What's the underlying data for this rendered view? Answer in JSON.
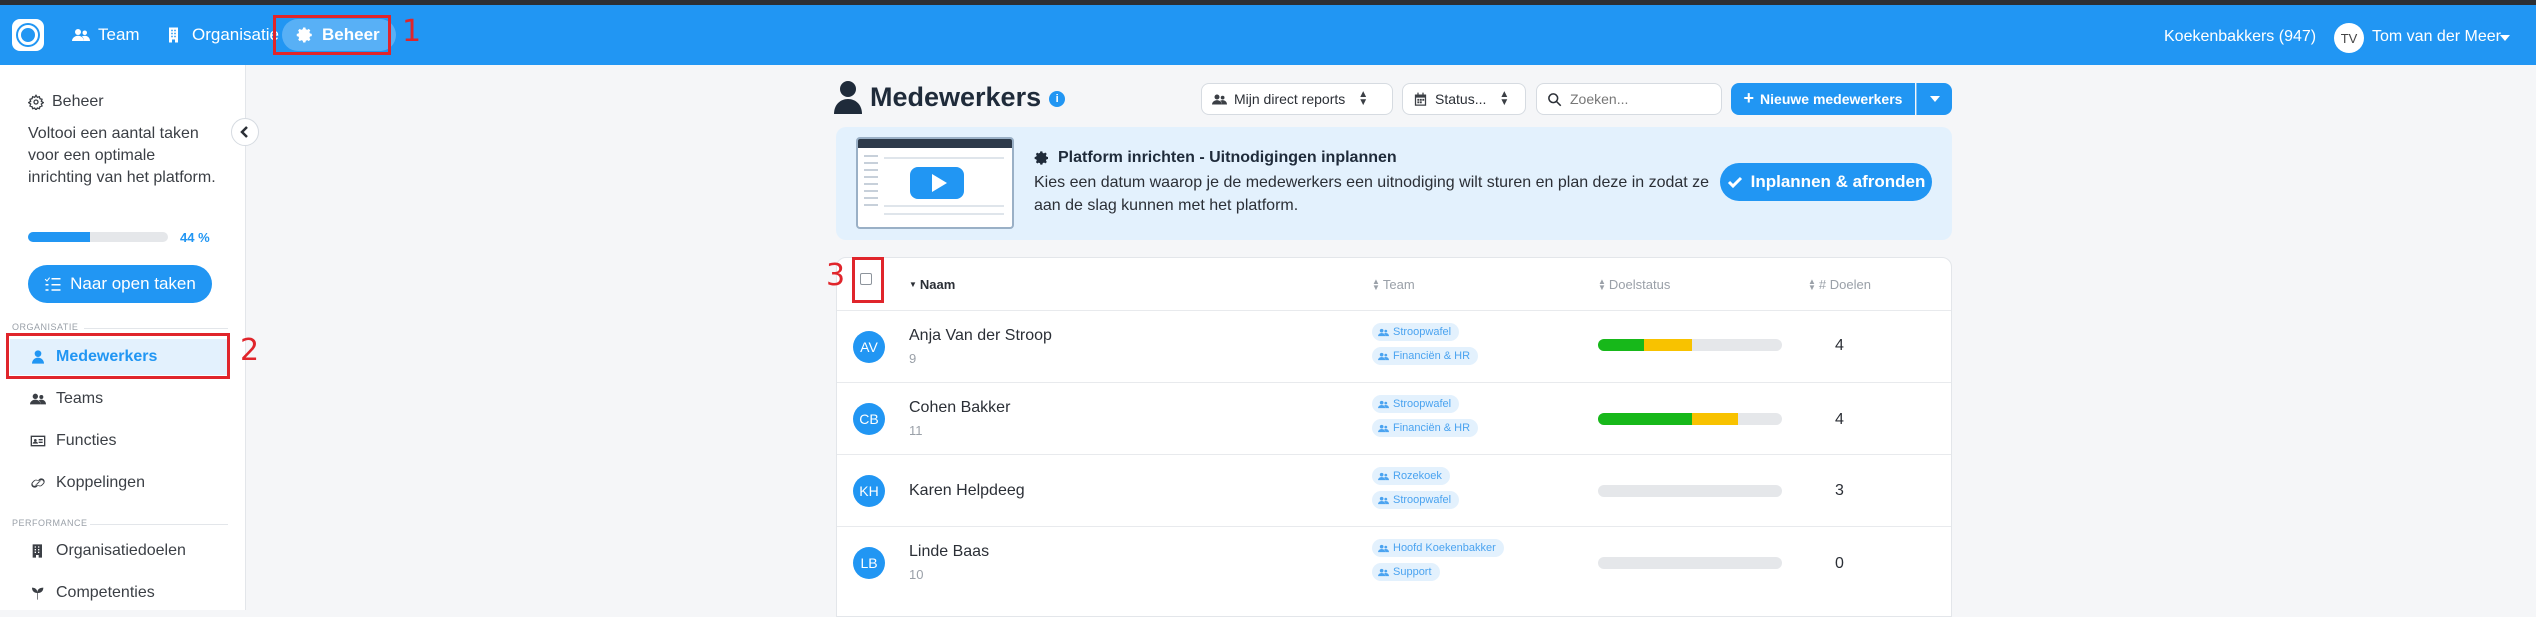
{
  "topbar": {
    "nav": [
      {
        "label": "Team",
        "icon": "users-icon"
      },
      {
        "label": "Organisatie",
        "icon": "building-icon"
      },
      {
        "label": "Beheer",
        "icon": "gear-icon",
        "active": true
      }
    ],
    "org_name": "Koekenbakkers (947)",
    "user_initials": "TV",
    "user_name": "Tom van der Meer"
  },
  "annotations": [
    "1",
    "2",
    "3"
  ],
  "sidebar": {
    "beheer_title": "Beheer",
    "intro_text": "Voltooi een aantal taken voor een optimale inrichting van het platform.",
    "progress_value": 44,
    "progress_label": "44 %",
    "open_tasks_button": "Naar open taken",
    "sections": [
      {
        "label": "ORGANISATIE",
        "items": [
          {
            "label": "Medewerkers",
            "icon": "person-icon",
            "active": true
          },
          {
            "label": "Teams",
            "icon": "users-icon"
          },
          {
            "label": "Functies",
            "icon": "id-card-icon"
          },
          {
            "label": "Koppelingen",
            "icon": "link-icon"
          }
        ]
      },
      {
        "label": "PERFORMANCE",
        "items": [
          {
            "label": "Organisatiedoelen",
            "icon": "building-icon"
          },
          {
            "label": "Competenties",
            "icon": "seedling-icon"
          }
        ]
      }
    ]
  },
  "main": {
    "title": "Medewerkers",
    "filters": {
      "reports": "Mijn direct reports",
      "status": "Status..."
    },
    "search_placeholder": "Zoeken...",
    "new_button": "Nieuwe medewerkers"
  },
  "banner": {
    "title": "Platform inrichten - Uitnodigingen inplannen",
    "text": "Kies een datum waarop je de medewerkers een uitnodiging wilt sturen en plan deze in zodat ze aan de slag kunnen met het platform.",
    "button": "Inplannen & afronden"
  },
  "table": {
    "columns": [
      "Naam",
      "Team",
      "Doelstatus",
      "# Doelen"
    ],
    "rows": [
      {
        "initials": "AV",
        "name": "Anja Van der Stroop",
        "sub": "9",
        "teams": [
          "Stroopwafel",
          "Financiën & HR"
        ],
        "goal_green": 0.25,
        "goal_yellow": 0.26,
        "goals": "4"
      },
      {
        "initials": "CB",
        "name": "Cohen Bakker",
        "sub": "11",
        "teams": [
          "Stroopwafel",
          "Financiën & HR"
        ],
        "goal_green": 0.51,
        "goal_yellow": 0.25,
        "goals": "4"
      },
      {
        "initials": "KH",
        "name": "Karen Helpdeeg",
        "sub": "",
        "teams": [
          "Rozekoek",
          "Stroopwafel"
        ],
        "goal_green": 0,
        "goal_yellow": 0,
        "goals": "3"
      },
      {
        "initials": "LB",
        "name": "Linde Baas",
        "sub": "10",
        "teams": [
          "Hoofd Koekenbakker",
          "Support"
        ],
        "goal_green": 0,
        "goal_yellow": 0,
        "goals": "0"
      }
    ]
  },
  "colors": {
    "primary": "#2196f3",
    "annotation": "#e0252b",
    "goal_green": "#17b81a",
    "goal_yellow": "#f8c200"
  }
}
